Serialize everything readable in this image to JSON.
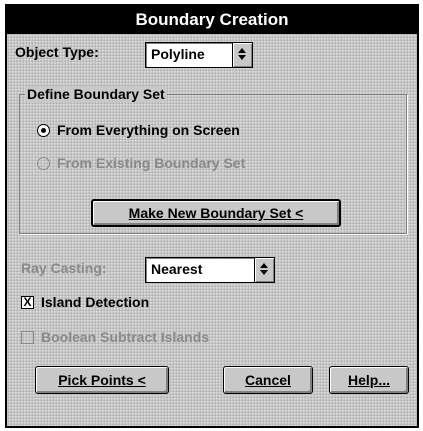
{
  "window": {
    "title": "Boundary Creation"
  },
  "object_type": {
    "label": "Object Type:",
    "value": "Polyline"
  },
  "boundary_set": {
    "group_title": "Define Boundary Set",
    "option_everything": "From Everything on Screen",
    "option_existing": "From Existing Boundary Set",
    "make_new_button": "Make New Boundary Set <"
  },
  "ray_casting": {
    "label": "Ray Casting:",
    "value": "Nearest"
  },
  "island_detection": {
    "label": "Island Detection",
    "checked": true
  },
  "boolean_subtract": {
    "label": "Boolean Subtract Islands",
    "checked": false
  },
  "buttons": {
    "pick_points": "Pick Points <",
    "cancel": "Cancel",
    "help": "Help..."
  },
  "check_mark": "X"
}
